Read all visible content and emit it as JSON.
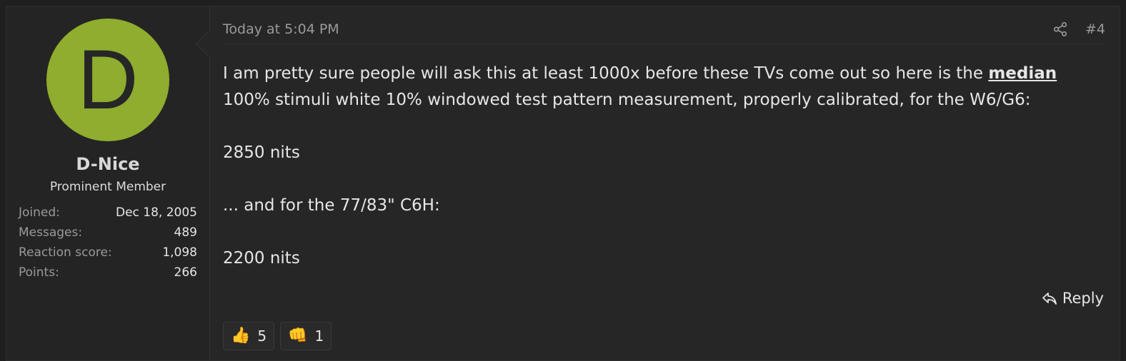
{
  "user": {
    "avatar_letter": "D",
    "avatar_color": "#8fad2e",
    "name": "D-Nice",
    "title": "Prominent Member",
    "stats": [
      {
        "label": "Joined:",
        "value": "Dec 18, 2005"
      },
      {
        "label": "Messages:",
        "value": "489"
      },
      {
        "label": "Reaction score:",
        "value": "1,098"
      },
      {
        "label": "Points:",
        "value": "266"
      }
    ]
  },
  "post": {
    "timestamp": "Today at 5:04 PM",
    "number": "#4",
    "share_icon": "share-icon",
    "body": {
      "p1_before": "I am pretty sure people will ask this at least 1000x before these TVs come out so here is the ",
      "p1_bold": "median",
      "p1_after": " 100% stimuli white 10% windowed test pattern measurement, properly calibrated, for the W6/G6:",
      "p2": "2850 nits",
      "p3": "... and for the 77/83\" C6H:",
      "p4": "2200 nits"
    },
    "reply_label": "Reply",
    "reactions": [
      {
        "icon": "thumbs-up-icon",
        "emoji": "👍",
        "count": "5"
      },
      {
        "icon": "fist-bump-icon",
        "emoji": "👊",
        "count": "1"
      }
    ]
  }
}
